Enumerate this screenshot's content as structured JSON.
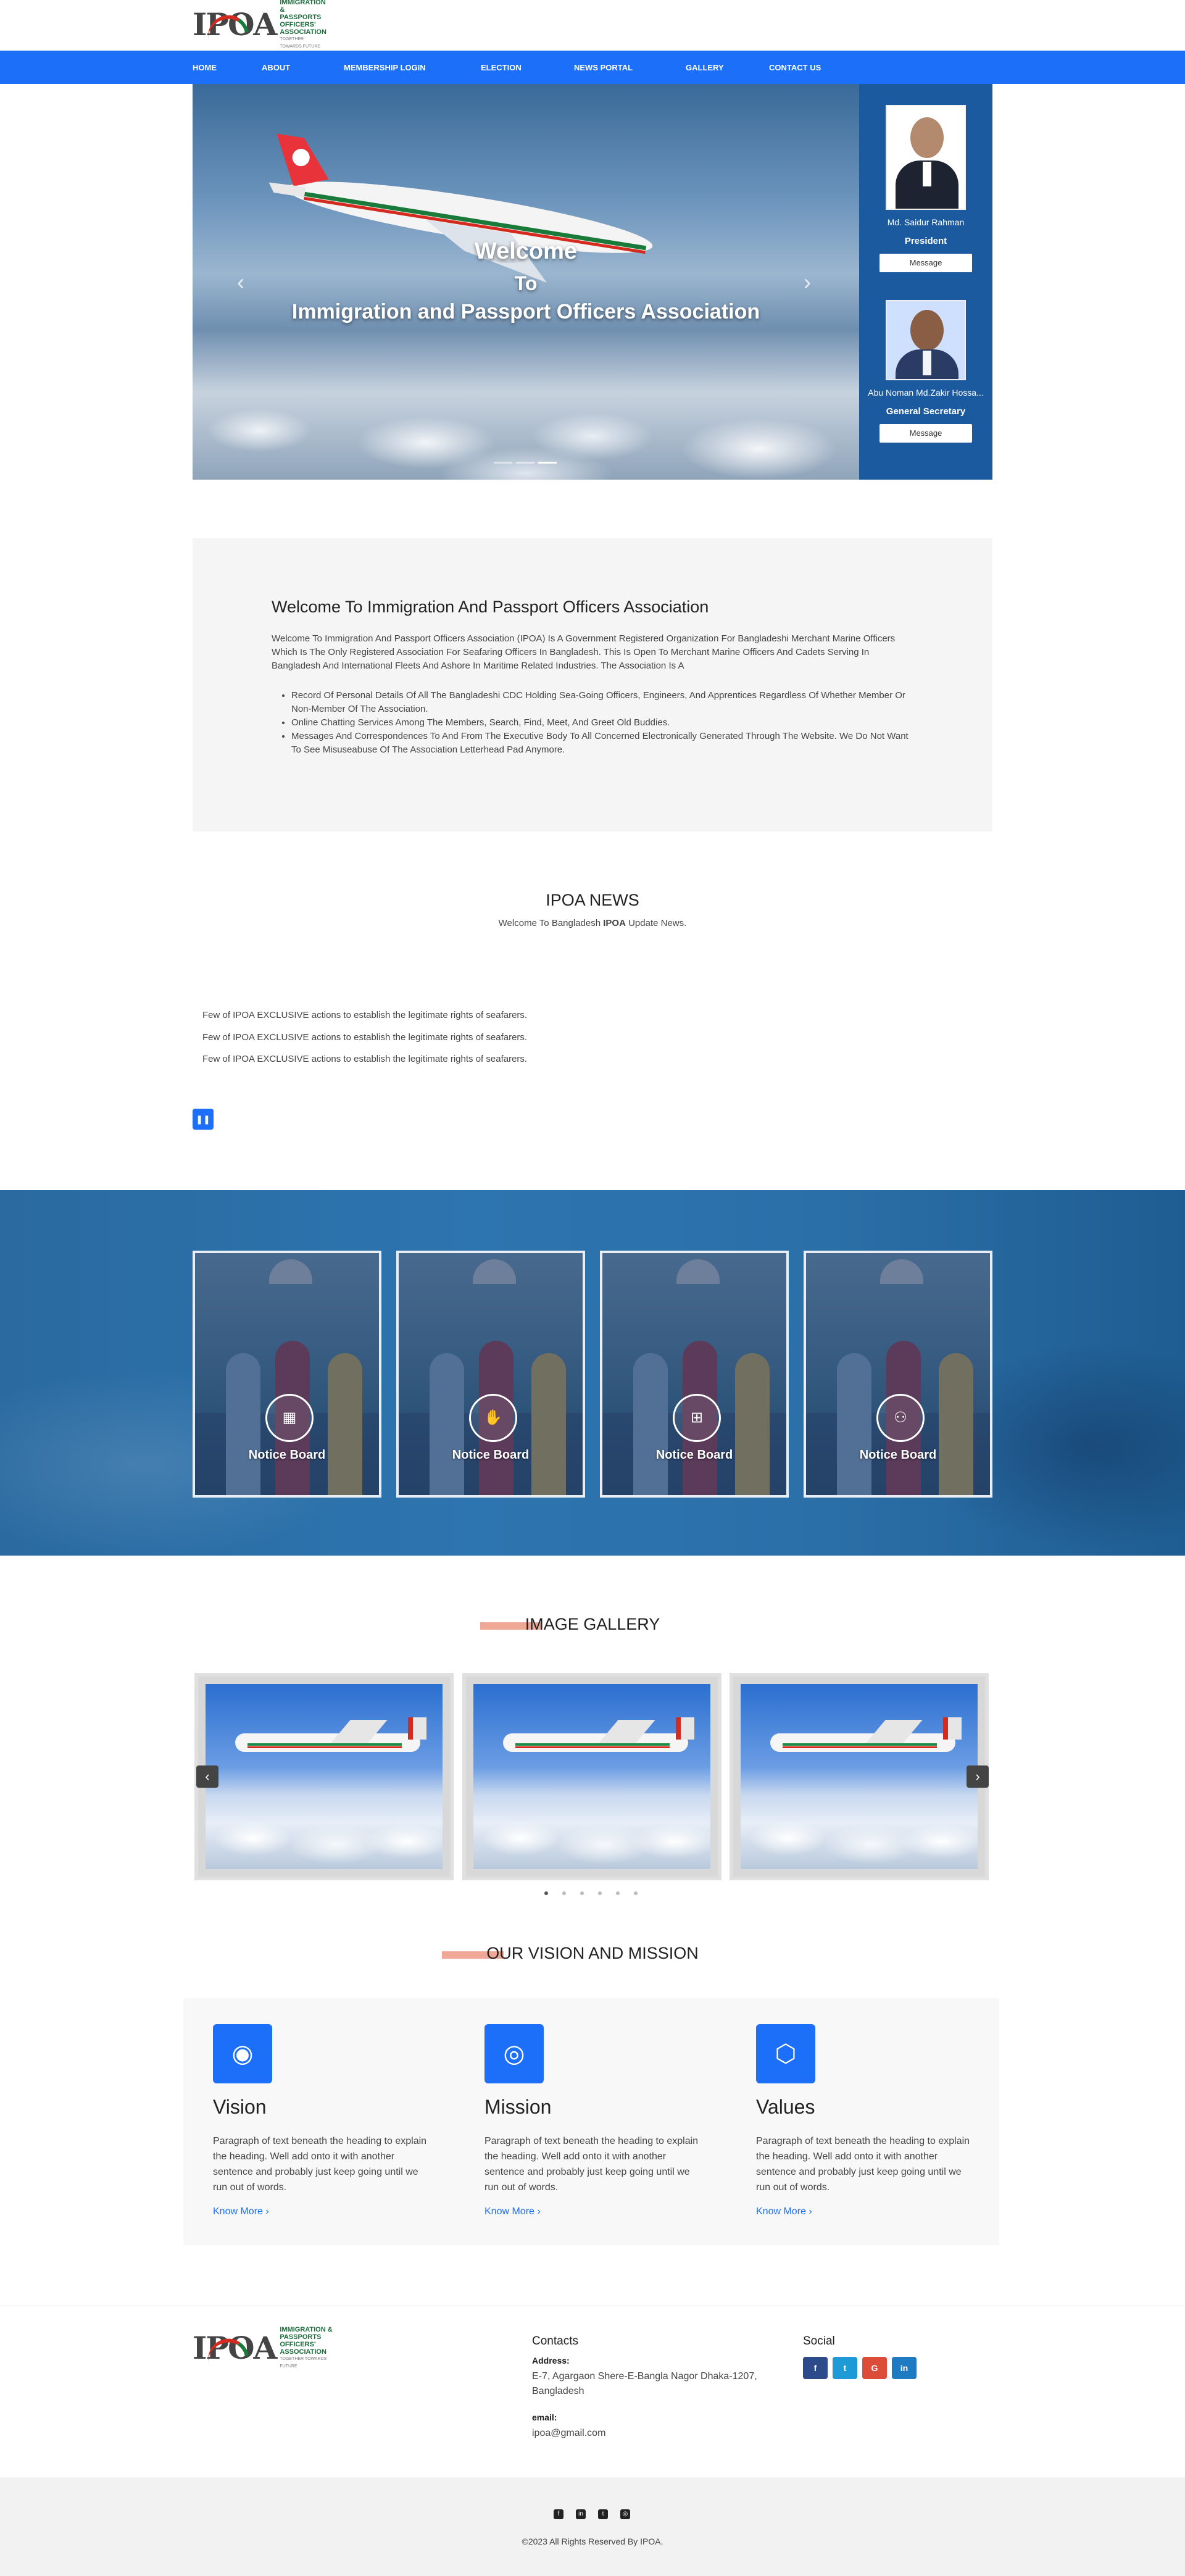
{
  "header": {
    "logo_mark": "IPOA",
    "logo_text_1": "Immigration &",
    "logo_text_2": "Passports Officers'",
    "logo_text_3": "Association",
    "logo_tagline": "Together towards future"
  },
  "nav": {
    "items": [
      {
        "label": "HOME"
      },
      {
        "label": "ABOUT"
      },
      {
        "label": "MEMBERSHIP LOGIN"
      },
      {
        "label": "ELECTION"
      },
      {
        "label": "NEWS PORTAL"
      },
      {
        "label": "GALLERY"
      },
      {
        "label": "CONTACT US"
      }
    ]
  },
  "hero": {
    "line1": "Welcome",
    "line2": "To",
    "line3": "Immigration and Passport Officers Association",
    "prev_icon": "chevron-left-icon",
    "next_icon": "chevron-right-icon",
    "active_slide": 3,
    "slide_count": 3
  },
  "officers": [
    {
      "name": "Md. Saidur Rahman",
      "role": "President",
      "button": "Message"
    },
    {
      "name": "Abu Noman Md.Zakir Hossa...",
      "role": "General Secretary",
      "button": "Message"
    }
  ],
  "welcome": {
    "title": "Welcome To Immigration And Passport Officers Association",
    "paragraph": "Welcome To Immigration And Passport Officers Association (IPOA) Is A Government Registered Organization For Bangladeshi Merchant Marine Officers Which Is The Only Registered Association For Seafaring Officers In Bangladesh. This Is Open To Merchant Marine Officers And Cadets Serving In Bangladesh And International Fleets And Ashore In Maritime Related Industries. The Association Is A",
    "bullets": [
      "Record Of Personal Details Of All The Bangladeshi CDC Holding Sea-Going Officers, Engineers, And Apprentices Regardless Of Whether Member Or Non-Member Of The Association.",
      "Online Chatting Services Among The Members, Search, Find, Meet, And Greet Old Buddies.",
      "Messages And Correspondences To And From The Executive Body To All Concerned Electronically Generated Through The Website. We Do Not Want To See Misuseabuse Of The Association Letterhead Pad Anymore."
    ]
  },
  "news": {
    "title": "IPOA NEWS",
    "subtitle_before": "Welcome To Bangladesh ",
    "subtitle_bold": "IPOA",
    "subtitle_after": " Update News.",
    "items": [
      "Few of IPOA EXCLUSIVE actions to establish the legitimate rights of seafarers.",
      "Few of IPOA EXCLUSIVE actions to establish the legitimate rights of seafarers.",
      "Few of IPOA EXCLUSIVE actions to establish the legitimate rights of seafarers."
    ],
    "pause_icon": "pause-icon"
  },
  "notices": [
    {
      "label": "Notice Board",
      "icon": "calendar-icon",
      "glyph": "▦"
    },
    {
      "label": "Notice Board",
      "icon": "handshake-icon",
      "glyph": "✋"
    },
    {
      "label": "Notice Board",
      "icon": "windows-icon",
      "glyph": "⊞"
    },
    {
      "label": "Notice Board",
      "icon": "sitemap-icon",
      "glyph": "⚇"
    }
  ],
  "gallery": {
    "title": "IMAGE GALLERY",
    "prev_icon": "chevron-left-icon",
    "next_icon": "chevron-right-icon",
    "dot_count": 6,
    "active_dot": 1
  },
  "vision": {
    "title": "OUR VISION AND MISSION",
    "columns": [
      {
        "heading": "Vision",
        "icon": "eye-icon",
        "glyph": "◉",
        "text": "Paragraph of text beneath the heading to explain the heading. Well add onto it with another sentence and probably just keep going until we run out of words.",
        "link": "Know More"
      },
      {
        "heading": "Mission",
        "icon": "target-icon",
        "glyph": "◎",
        "text": "Paragraph of text beneath the heading to explain the heading. Well add onto it with another sentence and probably just keep going until we run out of words.",
        "link": "Know More"
      },
      {
        "heading": "Values",
        "icon": "cube-icon",
        "glyph": "⬡",
        "text": "Paragraph of text beneath the heading to explain the heading. Well add onto it with another sentence and probably just keep going until we run out of words.",
        "link": "Know More"
      }
    ]
  },
  "footer": {
    "contacts_title": "Contacts",
    "address_label": "Address:",
    "address": "E-7, Agargaon Shere-E-Bangla Nagor Dhaka-1207, Bangladesh",
    "email_label": "email:",
    "email": "ipoa@gmail.com",
    "social_title": "Social",
    "social": [
      {
        "icon": "facebook-icon",
        "glyph": "f",
        "color": "#2d4a8a"
      },
      {
        "icon": "twitter-icon",
        "glyph": "t",
        "color": "#1e9bd7"
      },
      {
        "icon": "google-icon",
        "glyph": "G",
        "color": "#dd4b39"
      },
      {
        "icon": "linkedin-icon",
        "glyph": "in",
        "color": "#1f7bc1"
      }
    ],
    "bottom_social": [
      {
        "icon": "facebook-icon",
        "glyph": "f"
      },
      {
        "icon": "linkedin-icon",
        "glyph": "in"
      },
      {
        "icon": "twitter-icon",
        "glyph": "t"
      },
      {
        "icon": "instagram-icon",
        "glyph": "◎"
      }
    ],
    "copyright": "©2023 All Rights Reserved By IPOA."
  }
}
